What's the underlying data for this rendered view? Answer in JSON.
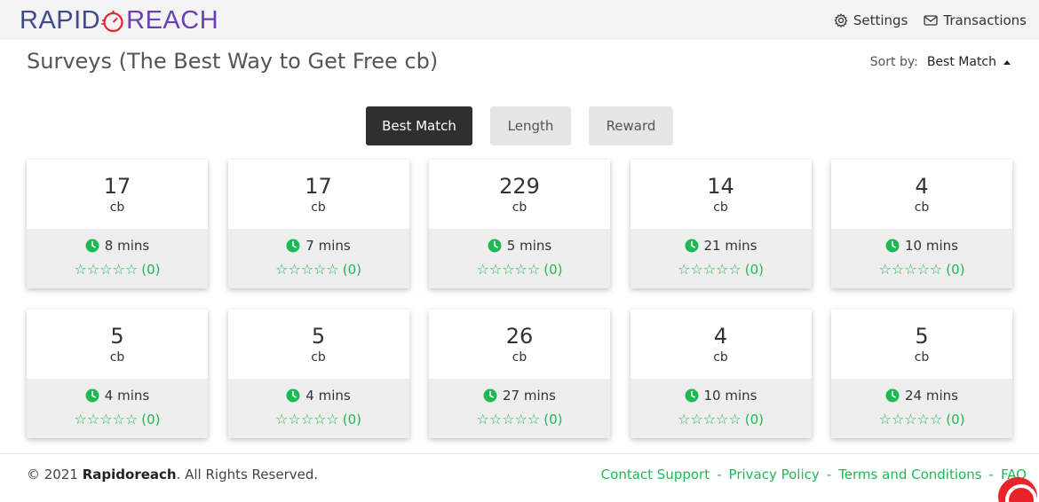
{
  "brand": {
    "left": "RAPID",
    "right": "REACH"
  },
  "nav": {
    "settings": "Settings",
    "transactions": "Transactions"
  },
  "page": {
    "title": "Surveys (The Best Way to Get Free cb)"
  },
  "sort": {
    "label": "Sort by:",
    "value": "Best Match"
  },
  "tabs": [
    {
      "label": "Best Match",
      "active": true
    },
    {
      "label": "Length",
      "active": false
    },
    {
      "label": "Reward",
      "active": false
    }
  ],
  "surveys": [
    {
      "amount": "17",
      "unit": "cb",
      "time": "8 mins",
      "rating": "(0)"
    },
    {
      "amount": "17",
      "unit": "cb",
      "time": "7 mins",
      "rating": "(0)"
    },
    {
      "amount": "229",
      "unit": "cb",
      "time": "5 mins",
      "rating": "(0)"
    },
    {
      "amount": "14",
      "unit": "cb",
      "time": "21 mins",
      "rating": "(0)"
    },
    {
      "amount": "4",
      "unit": "cb",
      "time": "10 mins",
      "rating": "(0)"
    },
    {
      "amount": "5",
      "unit": "cb",
      "time": "4 mins",
      "rating": "(0)"
    },
    {
      "amount": "5",
      "unit": "cb",
      "time": "4 mins",
      "rating": "(0)"
    },
    {
      "amount": "26",
      "unit": "cb",
      "time": "27 mins",
      "rating": "(0)"
    },
    {
      "amount": "4",
      "unit": "cb",
      "time": "10 mins",
      "rating": "(0)"
    },
    {
      "amount": "5",
      "unit": "cb",
      "time": "24 mins",
      "rating": "(0)"
    }
  ],
  "footer": {
    "copyright_prefix": "© 2021 ",
    "company": "Rapidoreach",
    "copyright_suffix": ". All Rights Reserved.",
    "links": [
      "Contact Support",
      "Privacy Policy",
      "Terms and Conditions",
      "FAQ"
    ],
    "separator": "-"
  },
  "colors": {
    "accent": "#1db954",
    "active_tab": "#2f2f2f",
    "brand_blue": "#3f4a8a",
    "brand_purple": "#6a3fb8",
    "brand_red": "#e8232b"
  },
  "icons": {
    "settings": "gear-icon",
    "transactions": "envelope-icon",
    "time": "clock-icon",
    "rating": "star-outline-icon",
    "chat": "chat-bubble-icon"
  }
}
